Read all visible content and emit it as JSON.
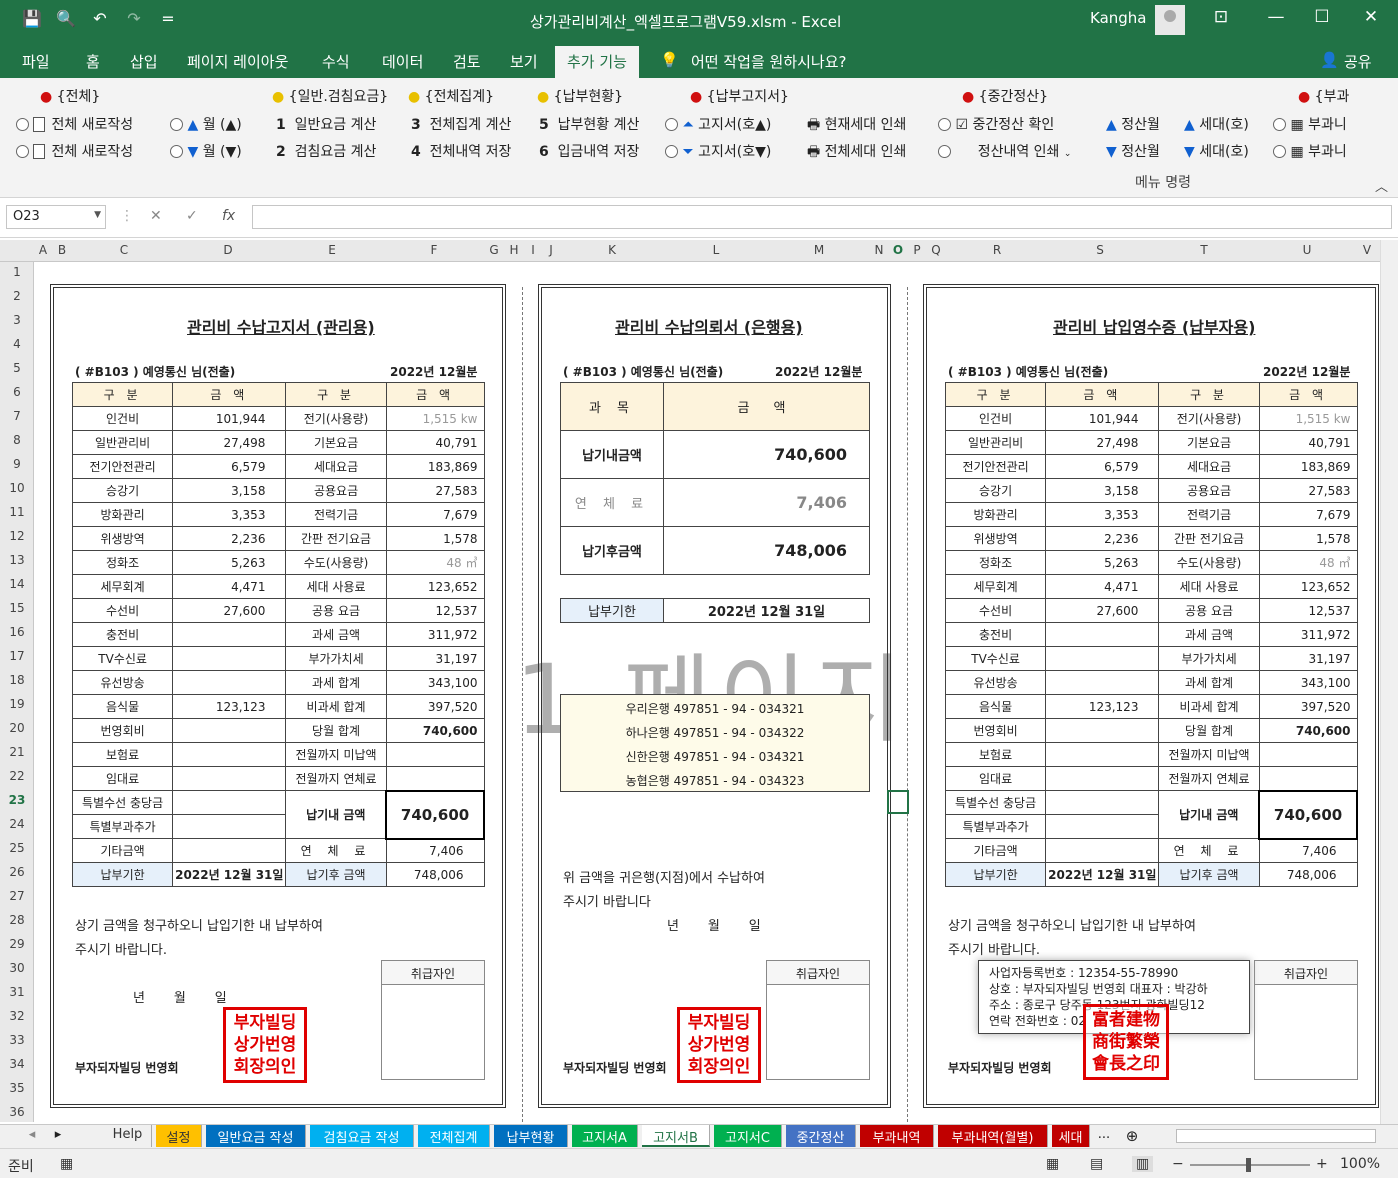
{
  "window": {
    "title": "상가관리비계산_엑셀프로그램V59.xlsm - Excel",
    "user": "Kangha",
    "qat_customize": "="
  },
  "menu_tabs": [
    "파일",
    "홈",
    "삽입",
    "페이지 레이아웃",
    "수식",
    "데이터",
    "검토",
    "보기",
    "추가 기능"
  ],
  "tell_me": "어떤 작업을 원하시나요?",
  "share": "공유",
  "ribbon": {
    "groups": {
      "all": "{전체}",
      "general": "{일반.검침요금}",
      "summary": "{전체집계}",
      "payment": "{납부현황}",
      "notice": "{납부고지서}",
      "interim": "{중간정산}",
      "extra": "{부과"
    },
    "row1": {
      "new_all": "전체 새로작성",
      "month_up": "월 (▲)",
      "g1": "1",
      "general_calc": "일반요금 계산",
      "g3": "3",
      "summary_calc": "전체집계 계산",
      "g5": "5",
      "payment_calc": "납부현황 계산",
      "notice_up": "고지서(호▲)",
      "print_current": "현재세대 인쇄",
      "interim_check": "중간정산 확인",
      "settle_month_up": "정산월",
      "house_up": "세대(호)",
      "extra_r1": "부과니"
    },
    "row2": {
      "new_all": "전체 새로작성",
      "month_down": "월 (▼)",
      "g2": "2",
      "meter_calc": "검침요금 계산",
      "g4": "4",
      "detail_save": "전체내역 저장",
      "g6": "6",
      "deposit_save": "입금내역 저장",
      "notice_down": "고지서(호▼)",
      "print_all": "전체세대 인쇄",
      "interim_print": "정산내역 인쇄",
      "settle_month_down": "정산월",
      "house_down": "세대(호)",
      "extra_r2": "부과니"
    },
    "group_label": "메뉴 명령"
  },
  "formula_bar": {
    "name_box": "O23",
    "fx": "fx",
    "value": ""
  },
  "columns": [
    "A",
    "B",
    "C",
    "D",
    "E",
    "F",
    "G",
    "H",
    "I",
    "J",
    "K",
    "L",
    "M",
    "N",
    "O",
    "P",
    "Q",
    "R",
    "S",
    "T",
    "U",
    "V"
  ],
  "rows": [
    "1",
    "2",
    "3",
    "4",
    "5",
    "6",
    "7",
    "8",
    "9",
    "10",
    "11",
    "12",
    "13",
    "14",
    "15",
    "16",
    "17",
    "18",
    "19",
    "20",
    "21",
    "22",
    "23",
    "24",
    "25",
    "26",
    "27",
    "28",
    "29",
    "30",
    "31",
    "32",
    "33",
    "34",
    "35",
    "36"
  ],
  "bill": {
    "title_mgmt": "관리비 수납고지서 (관리용)",
    "title_payer": "관리비 납입영수증 (납부자용)",
    "recipient": "( #B103 ) 예영통신 님(전출)",
    "period": "2022년 12월분",
    "head_item": "구 분",
    "head_amount": "금 액",
    "left_rows": [
      {
        "label": "인건비",
        "value": "101,944"
      },
      {
        "label": "일반관리비",
        "value": "27,498"
      },
      {
        "label": "전기안전관리",
        "value": "6,579"
      },
      {
        "label": "승강기",
        "value": "3,158"
      },
      {
        "label": "방화관리",
        "value": "3,353"
      },
      {
        "label": "위생방역",
        "value": "2,236"
      },
      {
        "label": "정화조",
        "value": "5,263"
      },
      {
        "label": "세무회계",
        "value": "4,471"
      },
      {
        "label": "수선비",
        "value": "27,600"
      },
      {
        "label": "충전비",
        "value": ""
      },
      {
        "label": "TV수신료",
        "value": ""
      },
      {
        "label": "유선방송",
        "value": ""
      },
      {
        "label": "음식물",
        "value": "123,123"
      },
      {
        "label": "번영회비",
        "value": ""
      },
      {
        "label": "보험료",
        "value": ""
      },
      {
        "label": "임대료",
        "value": ""
      },
      {
        "label": "특별수선 충당금",
        "value": ""
      },
      {
        "label": "특별부과추가",
        "value": ""
      },
      {
        "label": "기타금액",
        "value": ""
      },
      {
        "label": "납부기한",
        "value": "2022년 12월 31일"
      }
    ],
    "right_rows": [
      {
        "label": "전기(사용량)",
        "value": "1,515 kw"
      },
      {
        "label": "기본요금",
        "value": "40,791"
      },
      {
        "label": "세대요금",
        "value": "183,869"
      },
      {
        "label": "공용요금",
        "value": "27,583"
      },
      {
        "label": "전력기금",
        "value": "7,679"
      },
      {
        "label": "간판 전기요금",
        "value": "1,578"
      },
      {
        "label": "수도(사용량)",
        "value": "48 ㎥"
      },
      {
        "label": "세대 사용료",
        "value": "123,652"
      },
      {
        "label": "공용 요금",
        "value": "12,537"
      },
      {
        "label": "과세 금액",
        "value": "311,972"
      },
      {
        "label": "부가가치세",
        "value": "31,197"
      },
      {
        "label": "과세 합계",
        "value": "343,100"
      },
      {
        "label": "비과세 합계",
        "value": "397,520"
      },
      {
        "label": "당월 합계",
        "value": "740,600"
      },
      {
        "label": "전월까지 미납액",
        "value": ""
      },
      {
        "label": "전월까지 연체료",
        "value": ""
      }
    ],
    "due_label": "납기내 금액",
    "due_value": "740,600",
    "late_label": "연 체 료",
    "late_value": "7,406",
    "after_label": "납기후 금액",
    "after_value": "748,006",
    "notice_line1": "상기 금액을 청구하오니 납입기한 내 납부하여",
    "notice_line2": "주시기 바랍니다.",
    "date_line": "년 월 일",
    "date_line_spaced": "년       월       일",
    "handler": "취급자인",
    "association": "부자되자빌딩 번영회",
    "seal": "부자빌딩 상가번영 회장의인",
    "seal_line1": "부자빌딩",
    "seal_line2": "상가번영",
    "seal_line3": "회장의인"
  },
  "bank_slip": {
    "title": "관리비 수납의뢰서 (은행용)",
    "head_subject": "과 목",
    "head_amount": "금 액",
    "due_label": "납기내금액",
    "due_value": "740,600",
    "late_label": "연 체 료",
    "late_value": "7,406",
    "after_label": "납기후금액",
    "after_value": "748,006",
    "deadline_label": "납부기한",
    "deadline_value": "2022년 12월 31일",
    "accounts": [
      "우리은행 497851 - 94 - 034321",
      "하나은행 497851 - 94 - 034322",
      "신한은행 497851 - 94 - 034321",
      "농협은행 497851 - 94 - 034323"
    ],
    "msg1": "위 금액을 귀은행(지점)에서 수납하여",
    "msg2": "주시기 바랍니다"
  },
  "business": {
    "reg": "사업자등록번호 : 12354-55-78990",
    "name": "상호 : 부자되자빌딩 번영회   대표자 : 박강하",
    "addr": "주소 : 종로구 당주동 123번지 광화빌딩12",
    "tel": "연락 전화번호 : 02",
    "seal_chars": "富者建物 商街繁榮 會長之印",
    "seal_line1": "富者建物",
    "seal_line2": "商街繁榮",
    "seal_line3": "會長之印"
  },
  "watermark": "1 페이지",
  "sheet_tabs": [
    {
      "label": "Help",
      "color": "#f0f0f0",
      "text": "#333"
    },
    {
      "label": "설정",
      "color": "#ffc000",
      "text": "#333"
    },
    {
      "label": "일반요금 작성",
      "color": "#0070c0",
      "text": "#fff"
    },
    {
      "label": "검침요금 작성",
      "color": "#00b0f0",
      "text": "#fff"
    },
    {
      "label": "전체집계",
      "color": "#00b0f0",
      "text": "#fff"
    },
    {
      "label": "납부현황",
      "color": "#0070c0",
      "text": "#fff"
    },
    {
      "label": "고지서A",
      "color": "#00b050",
      "text": "#fff"
    },
    {
      "label": "고지서B",
      "color": "#ffffff",
      "text": "#217346"
    },
    {
      "label": "고지서C",
      "color": "#00b050",
      "text": "#fff"
    },
    {
      "label": "중간정산",
      "color": "#4472c4",
      "text": "#fff"
    },
    {
      "label": "부과내역",
      "color": "#c00000",
      "text": "#fff"
    },
    {
      "label": "부과내역(월별)",
      "color": "#c00000",
      "text": "#fff"
    },
    {
      "label": "세대",
      "color": "#c00000",
      "text": "#fff"
    }
  ],
  "status": {
    "ready": "준비",
    "zoom": "100%",
    "more": "..."
  }
}
